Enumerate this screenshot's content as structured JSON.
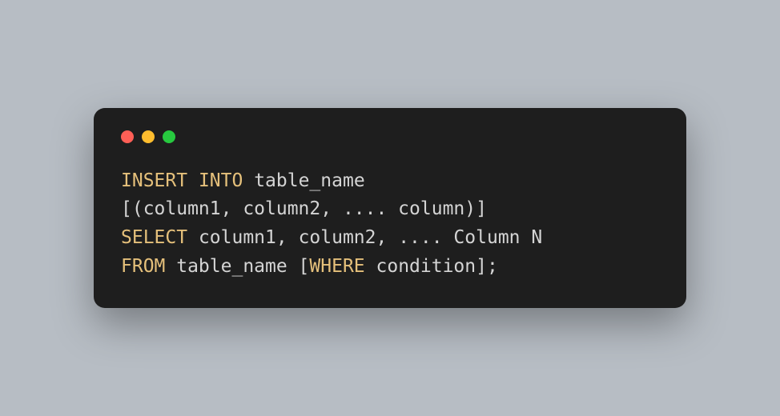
{
  "code": {
    "line1": {
      "kw1": "INSERT",
      "kw2": "INTO",
      "rest": " table_name"
    },
    "line2": "[(column1, column2, .... column)]",
    "line3": {
      "kw": "SELECT",
      "rest": " column1, column2, .... Column N"
    },
    "line4": {
      "kw1": "FROM",
      "mid": " table_name [",
      "kw2": "WHERE",
      "end": " condition];"
    }
  }
}
